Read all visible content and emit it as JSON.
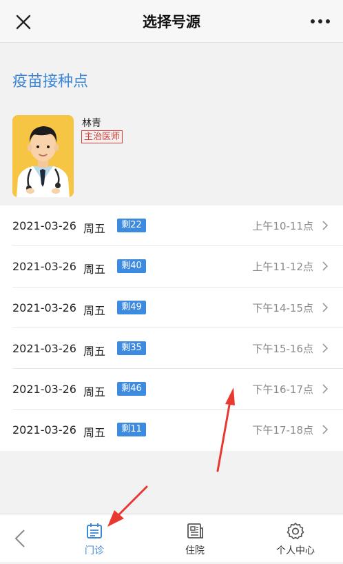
{
  "navbar": {
    "title": "选择号源",
    "close_icon": "close-icon",
    "more_icon": "more-dots-icon"
  },
  "site": {
    "title": "疫苗接种点"
  },
  "doctor": {
    "name": "林青",
    "title": "主治医师",
    "avatar_icon": "doctor-avatar-icon"
  },
  "slots": [
    {
      "date": "2021-03-26",
      "weekday": "周五",
      "remaining": "剩22",
      "time": "上午10-11点"
    },
    {
      "date": "2021-03-26",
      "weekday": "周五",
      "remaining": "剩40",
      "time": "上午11-12点"
    },
    {
      "date": "2021-03-26",
      "weekday": "周五",
      "remaining": "剩49",
      "time": "下午14-15点"
    },
    {
      "date": "2021-03-26",
      "weekday": "周五",
      "remaining": "剩35",
      "time": "下午15-16点"
    },
    {
      "date": "2021-03-26",
      "weekday": "周五",
      "remaining": "剩46",
      "time": "下午16-17点"
    },
    {
      "date": "2021-03-26",
      "weekday": "周五",
      "remaining": "剩11",
      "time": "下午17-18点"
    }
  ],
  "tabbar": {
    "back_icon": "chevron-left-icon",
    "tabs": [
      {
        "label": "门诊",
        "icon": "calendar-icon",
        "active": true
      },
      {
        "label": "住院",
        "icon": "newspaper-icon",
        "active": false
      },
      {
        "label": "个人中心",
        "icon": "gear-icon",
        "active": false
      }
    ]
  },
  "colors": {
    "accent": "#3e87d8",
    "badge": "#3d8be0",
    "doctor_title": "#d93b35",
    "annotation_arrow": "#e8382f"
  }
}
